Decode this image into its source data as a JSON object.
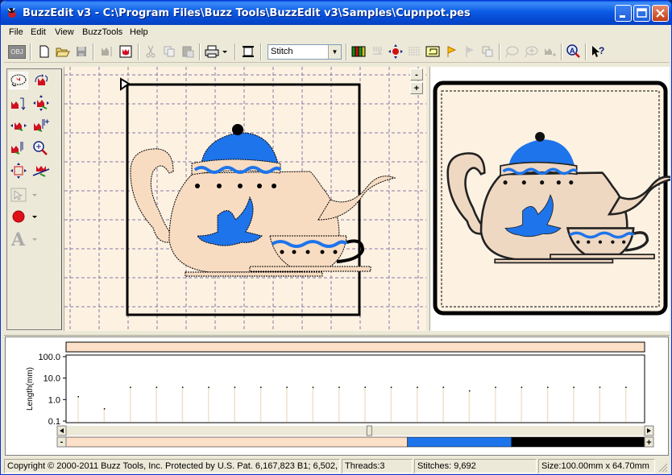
{
  "window": {
    "title": "BuzzEdit v3 - C:\\Program Files\\Buzz Tools\\BuzzEdit v3\\Samples\\Cupnpot.pes"
  },
  "menu": [
    "File",
    "Edit",
    "View",
    "BuzzTools",
    "Help"
  ],
  "toolbar": {
    "obj_label": "OBJ",
    "stitch_select_value": "Stitch",
    "buttons": [
      "obj",
      "new",
      "open",
      "save",
      "stitch-edit",
      "show-design",
      "cut",
      "copy",
      "paste",
      "print",
      "print-dropdown",
      "hoop",
      "thread-colors",
      "jump",
      "move-center",
      "satin",
      "sewing-machine",
      "flag-start",
      "flag-end",
      "overlay",
      "balloon-1",
      "balloon-2",
      "add-stitch",
      "zoom-text",
      "help-pointer"
    ]
  },
  "left_tools": [
    "lasso-select",
    "rotate-select",
    "reorder-down",
    "move-all",
    "expand",
    "split",
    "insert-stitch",
    "zoom-in",
    "resize",
    "delete-cross",
    "select-pointer",
    "color-fill",
    "text"
  ],
  "zoom": {
    "minus_label": "-",
    "plus_label": "+"
  },
  "design": {
    "fabric_color": "#fdf2e2",
    "thread_colors": [
      "#f5dcc4",
      "#1e74ea",
      "#000000"
    ]
  },
  "chart_data": {
    "type": "bar",
    "title": "",
    "ylabel": "Length(mm)",
    "yscale": "log",
    "yticks": [
      "100.0",
      "10.0",
      "1.0",
      "0.1"
    ],
    "ylim": [
      0.1,
      100
    ],
    "values": [
      1.4,
      0.38,
      3.8,
      3.8,
      3.8,
      3.8,
      3.8,
      3.8,
      3.8,
      3.8,
      3.8,
      3.8,
      3.8,
      3.8,
      3.8,
      2.6,
      3.8,
      3.8,
      3.8,
      3.8,
      3.8,
      3.8
    ]
  },
  "thread_bar": {
    "minus_label": "-",
    "plus_label": "+",
    "segments": [
      {
        "color": "#fde0c8",
        "fraction": 0.59
      },
      {
        "color": "#1e74ea",
        "fraction": 0.18
      },
      {
        "color": "#000000",
        "fraction": 0.23
      }
    ],
    "scroll_position": 0.52
  },
  "status": {
    "copyright": "Copyright © 2000-2011 Buzz Tools, Inc. Protected by U.S. Pat. 6,167,823 B1; 6,502,",
    "threads": "Threads:3",
    "stitches": "Stitches: 9,692",
    "size": "Size:100.00mm x 64.70mm"
  }
}
